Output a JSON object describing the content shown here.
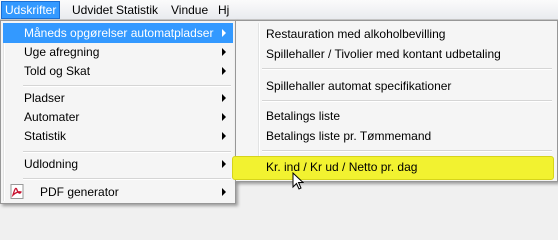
{
  "menubar": {
    "items": [
      "Udskrifter",
      "Udvidet Statistik",
      "Vindue",
      "Hj"
    ]
  },
  "main_menu": {
    "items": [
      {
        "label": "Måneds opgørelser automatpladser",
        "submenu": true
      },
      {
        "label": "Uge afregning",
        "submenu": true
      },
      {
        "label": "Told og Skat",
        "submenu": true
      },
      {
        "label": "Pladser",
        "submenu": true
      },
      {
        "label": "Automater",
        "submenu": true
      },
      {
        "label": "Statistik",
        "submenu": true
      },
      {
        "label": "Udlodning",
        "submenu": true
      },
      {
        "label": "PDF generator",
        "submenu": true
      }
    ]
  },
  "sub_menu": {
    "items": [
      {
        "label": "Restauration med alkoholbevilling"
      },
      {
        "label": "Spillehaller / Tivolier med kontant udbetaling"
      },
      {
        "label": "Spillehaller  automat specifikationer"
      },
      {
        "label": "Betalings liste"
      },
      {
        "label": "Betalings liste pr. Tømmemand"
      },
      {
        "label": "Kr. ind / Kr ud / Netto pr. dag"
      }
    ]
  },
  "colors": {
    "highlight": "#3399ff",
    "hover_yellow": "#f2f230"
  },
  "icons": {
    "pdf": "pdf-icon",
    "cursor": "mouse-pointer-icon"
  }
}
